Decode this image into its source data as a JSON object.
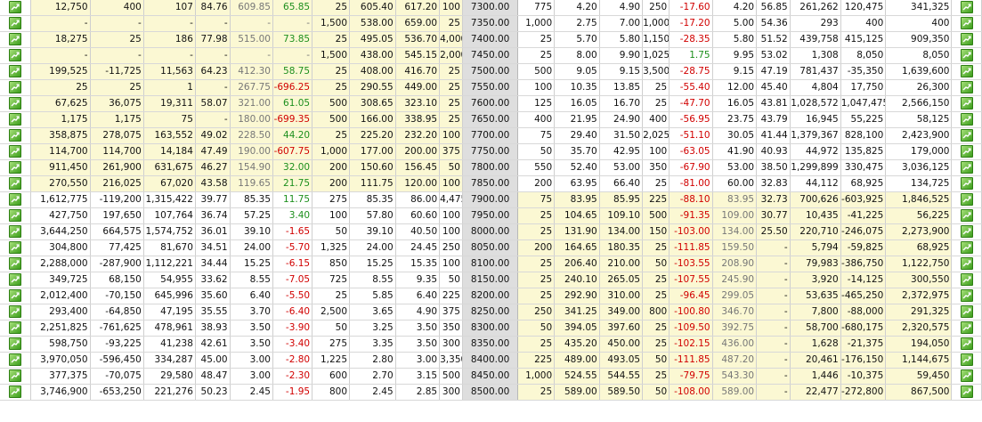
{
  "colors": {
    "itm_bg": "#fbf8d3",
    "strike_bg": "#dedede",
    "negative": "#d10000",
    "positive": "#1d8f1d",
    "icon": "#3c9d1b"
  },
  "icons": {
    "left": "chart-icon",
    "right": "chart-icon"
  },
  "rows": [
    {
      "strike": "7300.00",
      "itm": true,
      "call": [
        "12,750",
        "400",
        "107",
        "84.76",
        "609.85",
        "65.85",
        "25",
        "605.40",
        "617.20",
        "100"
      ],
      "put": [
        "775",
        "4.20",
        "4.90",
        "250",
        "-17.60",
        "4.20",
        "56.85",
        "261,262",
        "120,475",
        "341,325"
      ]
    },
    {
      "strike": "7350.00",
      "itm": true,
      "call": [
        "-",
        "-",
        "-",
        "-",
        "-",
        "-",
        "1,500",
        "538.00",
        "659.00",
        "25"
      ],
      "put": [
        "1,000",
        "2.75",
        "7.00",
        "1,000",
        "-17.20",
        "5.00",
        "54.36",
        "293",
        "400",
        "400"
      ]
    },
    {
      "strike": "7400.00",
      "itm": true,
      "call": [
        "18,275",
        "25",
        "186",
        "77.98",
        "515.00",
        "73.85",
        "25",
        "495.05",
        "536.70",
        "4,000"
      ],
      "put": [
        "25",
        "5.70",
        "5.80",
        "1,150",
        "-28.35",
        "5.80",
        "51.52",
        "439,758",
        "415,125",
        "909,350"
      ]
    },
    {
      "strike": "7450.00",
      "itm": true,
      "call": [
        "-",
        "-",
        "-",
        "-",
        "-",
        "-",
        "1,500",
        "438.00",
        "545.15",
        "2,000"
      ],
      "put": [
        "25",
        "8.00",
        "9.90",
        "1,025",
        "1.75",
        "9.95",
        "53.02",
        "1,308",
        "8,050",
        "8,050"
      ]
    },
    {
      "strike": "7500.00",
      "itm": true,
      "call": [
        "199,525",
        "-11,725",
        "11,563",
        "64.23",
        "412.30",
        "58.75",
        "25",
        "408.00",
        "416.70",
        "25"
      ],
      "put": [
        "500",
        "9.05",
        "9.15",
        "3,500",
        "-28.75",
        "9.15",
        "47.19",
        "781,437",
        "-35,350",
        "1,639,600"
      ]
    },
    {
      "strike": "7550.00",
      "itm": true,
      "call": [
        "25",
        "25",
        "1",
        "-",
        "267.75",
        "-696.25",
        "25",
        "290.55",
        "449.00",
        "25"
      ],
      "put": [
        "100",
        "10.35",
        "13.85",
        "25",
        "-55.40",
        "12.00",
        "45.40",
        "4,804",
        "17,750",
        "26,300"
      ]
    },
    {
      "strike": "7600.00",
      "itm": true,
      "call": [
        "67,625",
        "36,075",
        "19,311",
        "58.07",
        "321.00",
        "61.05",
        "500",
        "308.65",
        "323.10",
        "25"
      ],
      "put": [
        "125",
        "16.05",
        "16.70",
        "25",
        "-47.70",
        "16.05",
        "43.81",
        "1,028,572",
        "1,047,475",
        "2,566,150"
      ]
    },
    {
      "strike": "7650.00",
      "itm": true,
      "call": [
        "1,175",
        "1,175",
        "75",
        "-",
        "180.00",
        "-699.35",
        "500",
        "166.00",
        "338.95",
        "25"
      ],
      "put": [
        "400",
        "21.95",
        "24.90",
        "400",
        "-56.95",
        "23.75",
        "43.79",
        "16,945",
        "55,225",
        "58,125"
      ]
    },
    {
      "strike": "7700.00",
      "itm": true,
      "call": [
        "358,875",
        "278,075",
        "163,552",
        "49.02",
        "228.50",
        "44.20",
        "25",
        "225.20",
        "232.20",
        "100"
      ],
      "put": [
        "75",
        "29.40",
        "31.50",
        "2,025",
        "-51.10",
        "30.05",
        "41.44",
        "1,379,367",
        "828,100",
        "2,423,900"
      ]
    },
    {
      "strike": "7750.00",
      "itm": true,
      "call": [
        "114,700",
        "114,700",
        "14,184",
        "47.49",
        "190.00",
        "-607.75",
        "1,000",
        "177.00",
        "200.00",
        "375"
      ],
      "put": [
        "50",
        "35.70",
        "42.95",
        "100",
        "-63.05",
        "41.90",
        "40.93",
        "44,972",
        "135,825",
        "179,000"
      ]
    },
    {
      "strike": "7800.00",
      "itm": true,
      "call": [
        "911,450",
        "261,900",
        "631,675",
        "46.27",
        "154.90",
        "32.00",
        "200",
        "150.60",
        "156.45",
        "50"
      ],
      "put": [
        "550",
        "52.40",
        "53.00",
        "350",
        "-67.90",
        "53.00",
        "38.50",
        "1,299,899",
        "330,475",
        "3,036,125"
      ]
    },
    {
      "strike": "7850.00",
      "itm": true,
      "call": [
        "270,550",
        "216,025",
        "67,020",
        "43.58",
        "119.65",
        "21.75",
        "200",
        "111.75",
        "120.00",
        "100"
      ],
      "put": [
        "200",
        "63.95",
        "66.40",
        "25",
        "-81.00",
        "60.00",
        "32.83",
        "44,112",
        "68,925",
        "134,725"
      ]
    },
    {
      "strike": "7900.00",
      "itm": false,
      "call": [
        "1,612,775",
        "-119,200",
        "1,315,422",
        "39.77",
        "85.35",
        "11.75",
        "275",
        "85.35",
        "86.00",
        "4,475"
      ],
      "put": [
        "75",
        "83.95",
        "85.95",
        "225",
        "-88.10",
        "83.95",
        "32.73",
        "700,626",
        "-603,925",
        "1,846,525"
      ]
    },
    {
      "strike": "7950.00",
      "itm": false,
      "call": [
        "427,750",
        "197,650",
        "107,764",
        "36.74",
        "57.25",
        "3.40",
        "100",
        "57.80",
        "60.60",
        "100"
      ],
      "put": [
        "25",
        "104.65",
        "109.10",
        "500",
        "-91.35",
        "109.00",
        "30.77",
        "10,435",
        "-41,225",
        "56,225"
      ]
    },
    {
      "strike": "8000.00",
      "itm": false,
      "call": [
        "3,644,250",
        "664,575",
        "1,574,752",
        "36.01",
        "39.10",
        "-1.65",
        "50",
        "39.10",
        "40.50",
        "100"
      ],
      "put": [
        "25",
        "131.90",
        "134.00",
        "150",
        "-103.00",
        "134.00",
        "25.50",
        "220,710",
        "-246,075",
        "2,273,900"
      ]
    },
    {
      "strike": "8050.00",
      "itm": false,
      "call": [
        "304,800",
        "77,425",
        "81,670",
        "34.51",
        "24.00",
        "-5.70",
        "1,325",
        "24.00",
        "24.45",
        "250"
      ],
      "put": [
        "200",
        "164.65",
        "180.35",
        "25",
        "-111.85",
        "159.50",
        "-",
        "5,794",
        "-59,825",
        "68,925"
      ]
    },
    {
      "strike": "8100.00",
      "itm": false,
      "call": [
        "2,288,000",
        "-287,900",
        "1,112,221",
        "34.44",
        "15.25",
        "-6.15",
        "850",
        "15.25",
        "15.35",
        "100"
      ],
      "put": [
        "25",
        "206.40",
        "210.00",
        "50",
        "-103.55",
        "208.90",
        "-",
        "79,983",
        "-386,750",
        "1,122,750"
      ]
    },
    {
      "strike": "8150.00",
      "itm": false,
      "call": [
        "349,725",
        "68,150",
        "54,955",
        "33.62",
        "8.55",
        "-7.05",
        "725",
        "8.55",
        "9.35",
        "50"
      ],
      "put": [
        "25",
        "240.10",
        "265.05",
        "25",
        "-107.55",
        "245.90",
        "-",
        "3,920",
        "-14,125",
        "300,550"
      ]
    },
    {
      "strike": "8200.00",
      "itm": false,
      "call": [
        "2,012,400",
        "-70,150",
        "645,996",
        "35.60",
        "6.40",
        "-5.50",
        "25",
        "5.85",
        "6.40",
        "225"
      ],
      "put": [
        "25",
        "292.90",
        "310.00",
        "25",
        "-96.45",
        "299.05",
        "-",
        "53,635",
        "-465,250",
        "2,372,975"
      ]
    },
    {
      "strike": "8250.00",
      "itm": false,
      "call": [
        "293,400",
        "-64,850",
        "47,195",
        "35.55",
        "3.70",
        "-6.40",
        "2,500",
        "3.65",
        "4.90",
        "375"
      ],
      "put": [
        "250",
        "341.25",
        "349.00",
        "800",
        "-100.80",
        "346.70",
        "-",
        "7,800",
        "-88,000",
        "291,325"
      ]
    },
    {
      "strike": "8300.00",
      "itm": false,
      "call": [
        "2,251,825",
        "-761,625",
        "478,961",
        "38.93",
        "3.50",
        "-3.90",
        "50",
        "3.25",
        "3.50",
        "350"
      ],
      "put": [
        "50",
        "394.05",
        "397.60",
        "25",
        "-109.50",
        "392.75",
        "-",
        "58,700",
        "-680,175",
        "2,320,575"
      ]
    },
    {
      "strike": "8350.00",
      "itm": false,
      "call": [
        "598,750",
        "-93,225",
        "41,238",
        "42.61",
        "3.50",
        "-3.40",
        "275",
        "3.35",
        "3.50",
        "300"
      ],
      "put": [
        "25",
        "435.20",
        "450.00",
        "25",
        "-102.15",
        "436.00",
        "-",
        "1,628",
        "-21,375",
        "194,050"
      ]
    },
    {
      "strike": "8400.00",
      "itm": false,
      "call": [
        "3,970,050",
        "-596,450",
        "334,287",
        "45.00",
        "3.00",
        "-2.80",
        "1,225",
        "2.80",
        "3.00",
        "3,350"
      ],
      "put": [
        "225",
        "489.00",
        "493.05",
        "50",
        "-111.85",
        "487.20",
        "-",
        "20,461",
        "-176,150",
        "1,144,675"
      ]
    },
    {
      "strike": "8450.00",
      "itm": false,
      "call": [
        "377,375",
        "-70,075",
        "29,580",
        "48.47",
        "3.00",
        "-2.30",
        "600",
        "2.70",
        "3.15",
        "500"
      ],
      "put": [
        "1,000",
        "524.55",
        "544.55",
        "25",
        "-79.75",
        "543.30",
        "-",
        "1,446",
        "-10,375",
        "59,450"
      ]
    },
    {
      "strike": "8500.00",
      "itm": false,
      "call": [
        "3,746,900",
        "-653,250",
        "221,276",
        "50.23",
        "2.45",
        "-1.95",
        "800",
        "2.45",
        "2.85",
        "300"
      ],
      "put": [
        "25",
        "589.00",
        "589.50",
        "50",
        "-108.00",
        "589.00",
        "-",
        "22,477",
        "-272,800",
        "867,500"
      ]
    }
  ]
}
